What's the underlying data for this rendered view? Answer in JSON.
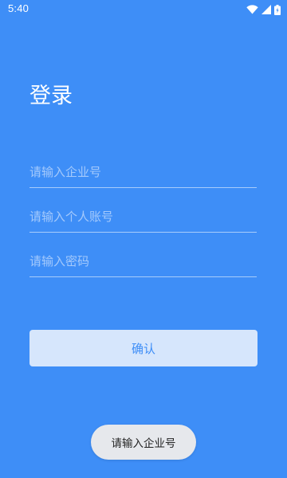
{
  "status_bar": {
    "time": "5:40",
    "icons": [
      "wifi-icon",
      "cellular-signal-icon",
      "battery-icon"
    ]
  },
  "page": {
    "title": "登录"
  },
  "form": {
    "company_placeholder": "请输入企业号",
    "account_placeholder": "请输入个人账号",
    "password_placeholder": "请输入密码",
    "company_value": "",
    "account_value": "",
    "password_value": ""
  },
  "actions": {
    "confirm_label": "确认"
  },
  "toast": {
    "message": "请输入企业号"
  },
  "colors": {
    "background": "#3e8ef7",
    "button_bg": "#d6e6fc",
    "button_text": "#3e8ef7",
    "toast_bg": "#e6e8ec"
  }
}
